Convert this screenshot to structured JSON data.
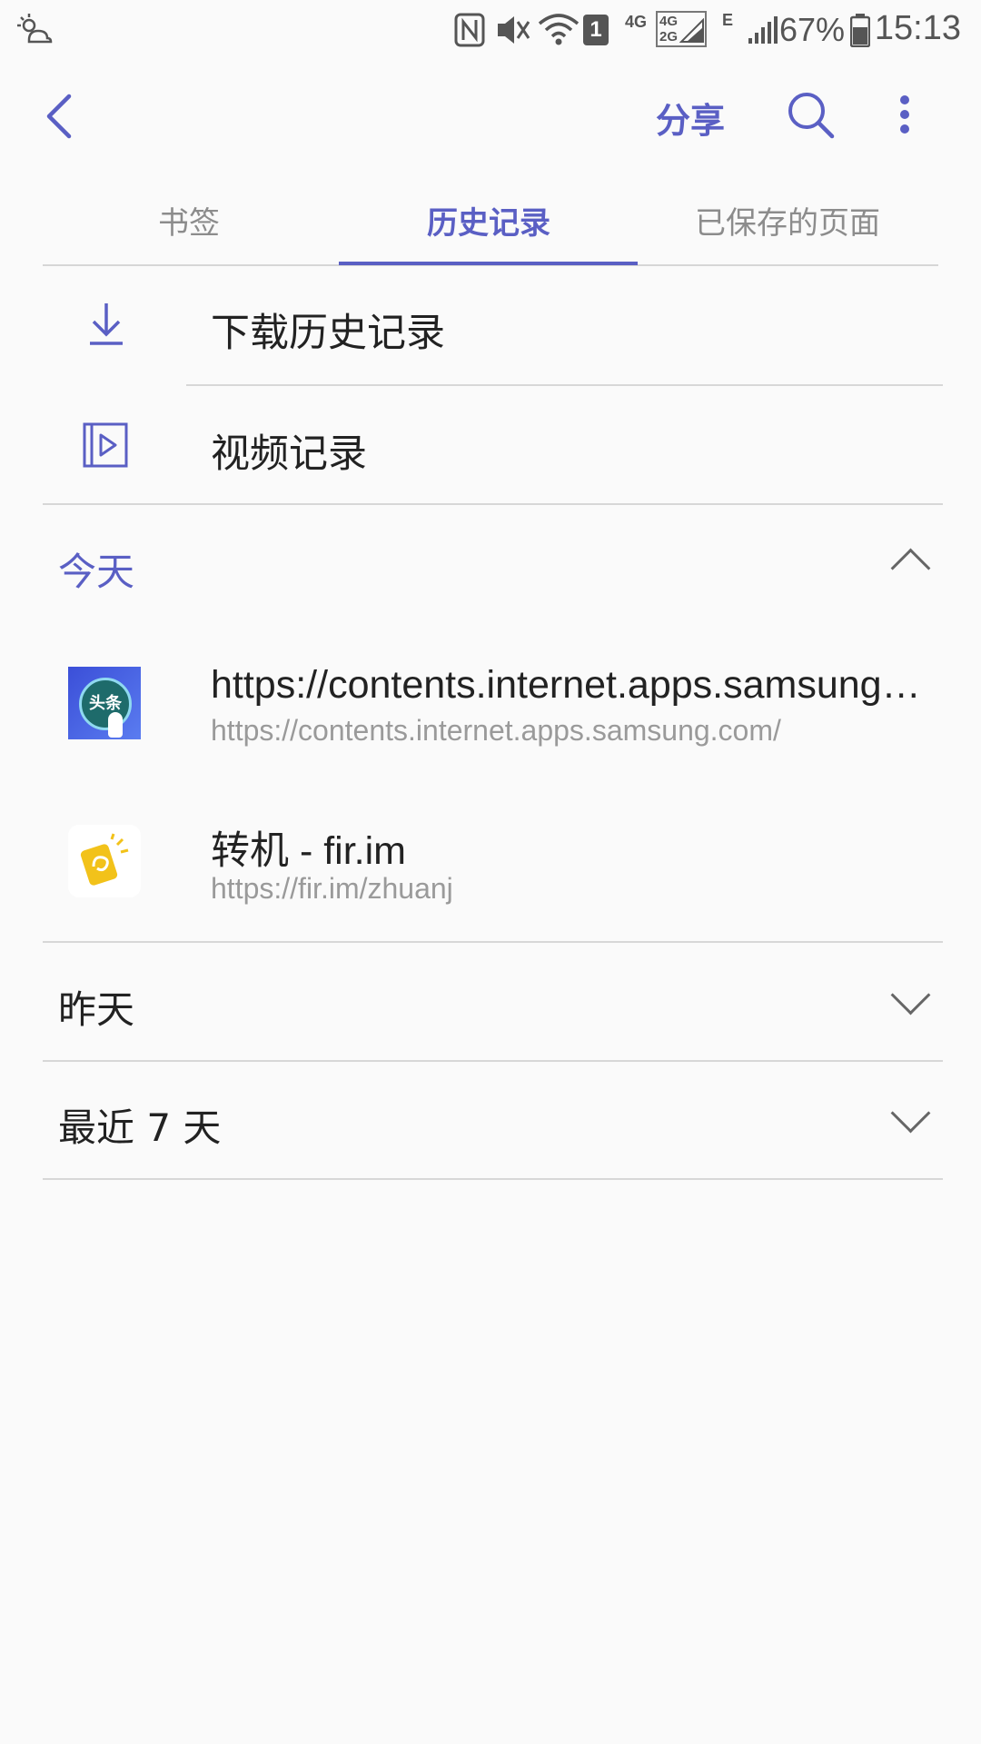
{
  "status_bar": {
    "time": "15:13",
    "battery": "67%",
    "network_labels": [
      "4G",
      "4G",
      "2G",
      "E"
    ],
    "sim_badge": "1",
    "icons": [
      "weather-icon",
      "nfc-icon",
      "mute-icon",
      "wifi-icon",
      "sim-icon",
      "signal-icon",
      "battery-icon"
    ]
  },
  "app_bar": {
    "share_label": "分享",
    "icons": [
      "back-arrow-icon",
      "search-icon",
      "more-vert-icon"
    ]
  },
  "tabs": [
    {
      "label": "书签",
      "selected": false
    },
    {
      "label": "历史记录",
      "selected": true
    },
    {
      "label": "已保存的页面",
      "selected": false
    }
  ],
  "menu": [
    {
      "label": "下载历史记录",
      "icon": "download-icon"
    },
    {
      "label": "视频记录",
      "icon": "video-icon"
    }
  ],
  "sections": [
    {
      "label": "今天",
      "expanded": true,
      "items": [
        {
          "title": "https://contents.internet.apps.samsung.com/",
          "url": "https://contents.internet.apps.samsung.com/",
          "favicon_text": "头条",
          "favicon": "toutiao-app-icon"
        },
        {
          "title": "转机 - fir.im",
          "url": "https://fir.im/zhuanj",
          "favicon": "fir-im-app-icon"
        }
      ]
    },
    {
      "label": "昨天",
      "expanded": false
    },
    {
      "label": "最近 7 天",
      "expanded": false
    }
  ],
  "colors": {
    "accent": "#5a5fc4",
    "background": "#fafafa",
    "divider": "#d7d7d7"
  }
}
